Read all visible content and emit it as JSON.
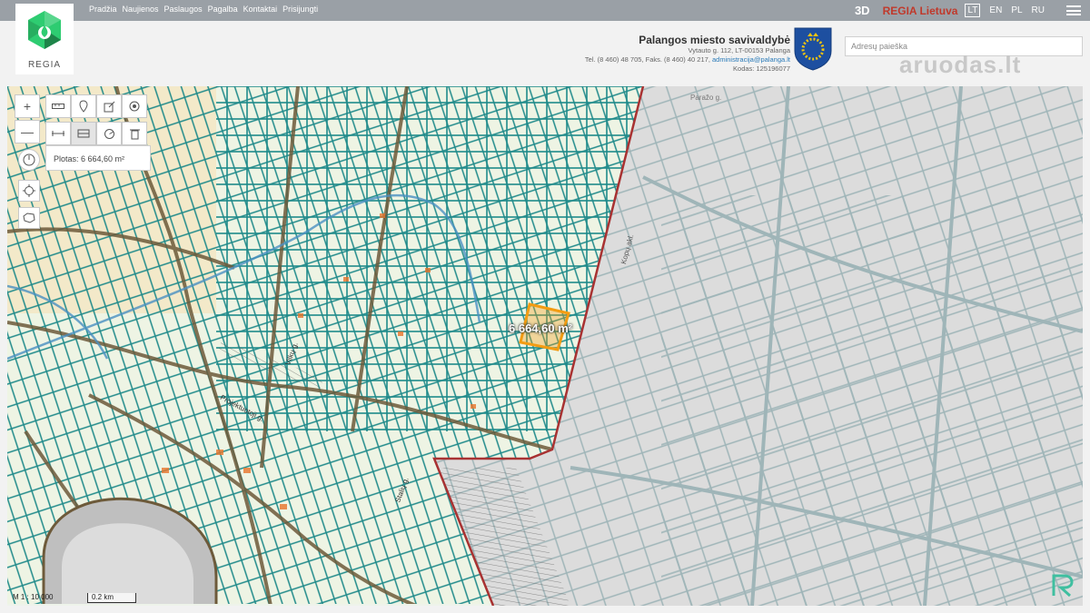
{
  "topnav": {
    "items": [
      "Pradžia",
      "Naujienos",
      "Paslaugos",
      "Pagalba",
      "Kontaktai",
      "Prisijungti"
    ],
    "btn_3d": "3D",
    "regia_lt": "REGIA Lietuva",
    "languages": [
      "LT",
      "EN",
      "PL",
      "RU"
    ],
    "active_language": "LT"
  },
  "logo": {
    "text": "REGIA",
    "colors": [
      "#2ecc71",
      "#27ae60",
      "#1e8449"
    ]
  },
  "municipality": {
    "name": "Palangos miesto savivaldybė",
    "address": "Vytauto g. 112, LT-00153 Palanga",
    "phone_prefix": "Tel. (8 460) 48 705, Faks. (8 460) 40 217, ",
    "email": "administracija@palanga.lt",
    "code": "Kodas: 125196077"
  },
  "search": {
    "placeholder": "Adresų paieška"
  },
  "watermark": {
    "text": "aruodas.lt"
  },
  "map": {
    "area_label": "Plotas: 6 664,60 m²",
    "parcel_label": "6 664,60 m²",
    "scale_ratio": "M 1 : 10 000",
    "scale_bar": "0.2 km",
    "colors": {
      "parcel": "#1f8a8a",
      "road": "#6d5a3a",
      "boundary": "#a83232",
      "highlight": "#f39c12",
      "greyed": "#9fb5b8"
    },
    "street_labels": [
      "Projektuotoji g.",
      "Vilkų g.",
      "Kopų akl.",
      "Paražo g.",
      "Stalių g."
    ]
  },
  "tools": {
    "zoom_in": "+",
    "zoom_out": "—"
  }
}
